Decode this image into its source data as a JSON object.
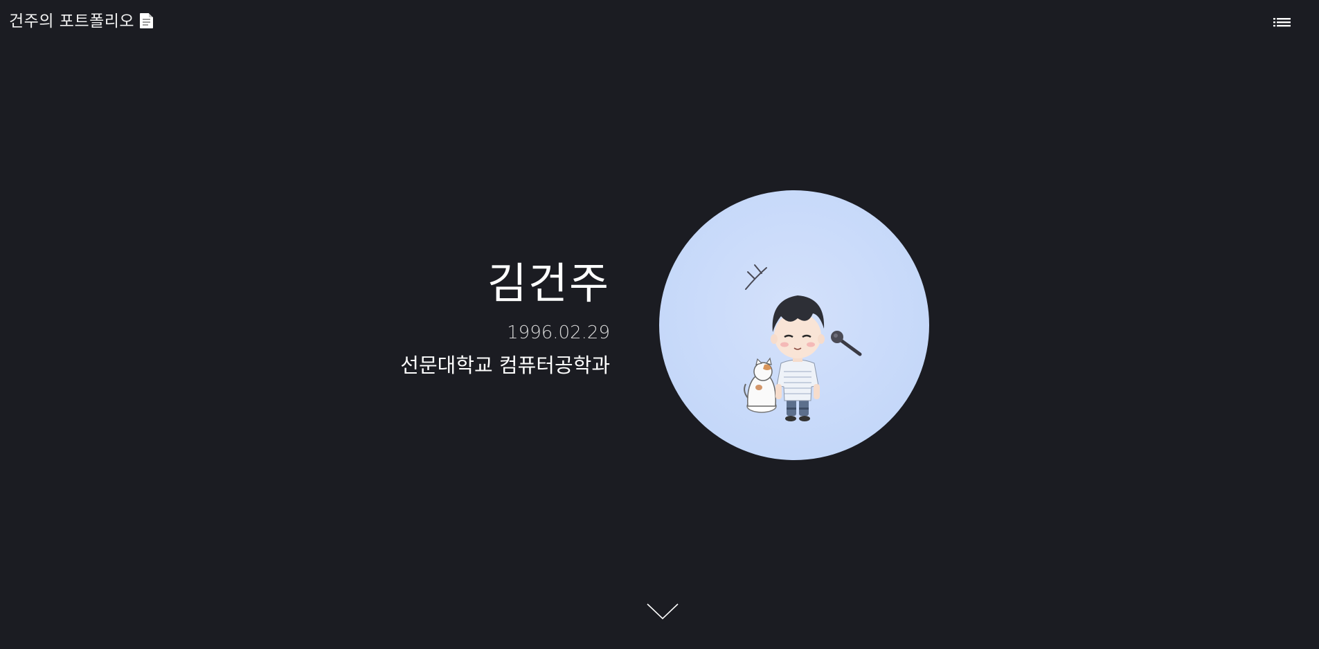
{
  "header": {
    "site_title": "건주의 포트폴리오",
    "title_icon": "document-icon",
    "menu_icon": "list-menu-icon"
  },
  "hero": {
    "name": "김건주",
    "birthdate": "1996.02.29",
    "school": "선문대학교 컴퓨터공학과",
    "avatar_bg_color": "#c5d8f9"
  },
  "scroll": {
    "icon": "chevron-down-icon"
  },
  "colors": {
    "background": "#1b1c22",
    "text": "#ffffff"
  }
}
